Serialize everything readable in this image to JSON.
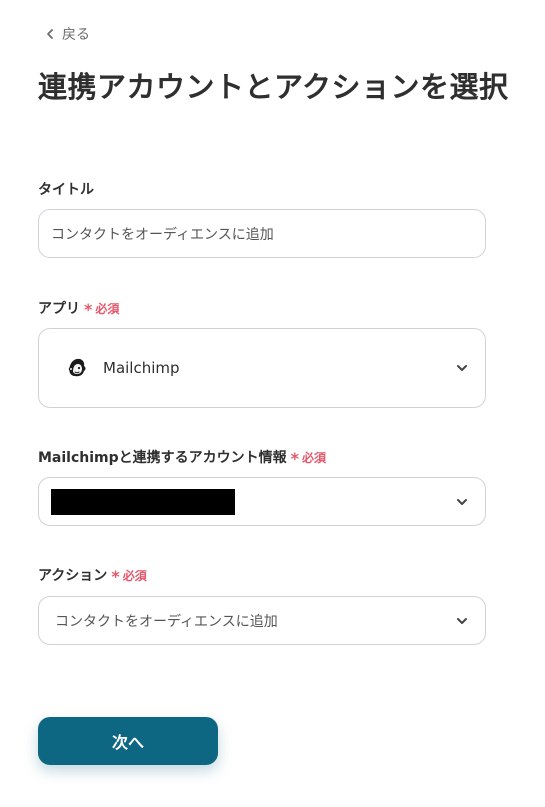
{
  "back": {
    "label": "戻る"
  },
  "title": "連携アカウントとアクションを選択",
  "required_label": "必須",
  "required_star": "*",
  "fields": {
    "title": {
      "label": "タイトル",
      "value": "コンタクトをオーディエンスに追加"
    },
    "app": {
      "label": "アプリ",
      "selected": "Mailchimp",
      "icon": "mailchimp-logo-icon"
    },
    "account": {
      "label": "Mailchimpと連携するアカウント情報",
      "value_redacted": true
    },
    "action": {
      "label": "アクション",
      "selected": "コンタクトをオーディエンスに追加"
    }
  },
  "next_button": {
    "label": "次へ"
  },
  "colors": {
    "accent": "#0e6782",
    "required": "#e5586b",
    "border": "#cfd3d8"
  }
}
